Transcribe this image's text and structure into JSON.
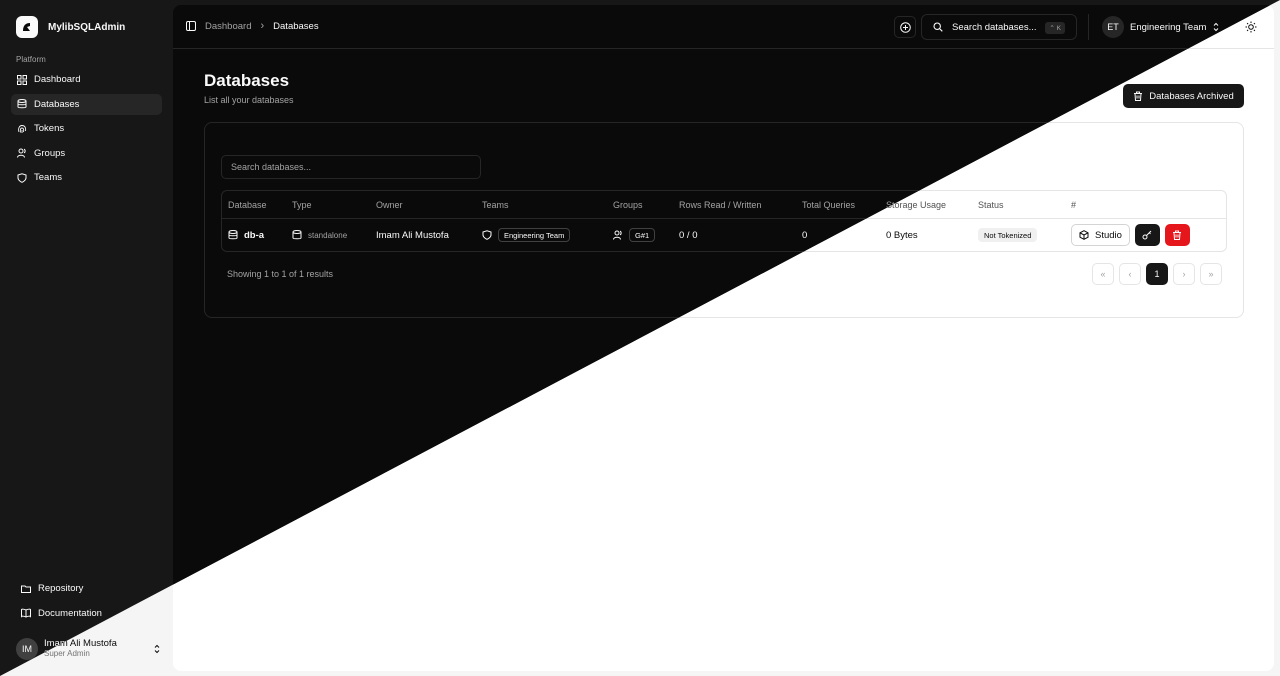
{
  "app": {
    "name": "MylibSQLAdmin"
  },
  "sidebar": {
    "section_label": "Platform",
    "items": [
      {
        "label": "Dashboard",
        "icon": "grid-icon"
      },
      {
        "label": "Databases",
        "icon": "database-icon",
        "active": true
      },
      {
        "label": "Tokens",
        "icon": "fingerprint-icon"
      },
      {
        "label": "Groups",
        "icon": "users-icon"
      },
      {
        "label": "Teams",
        "icon": "team-shield-icon"
      }
    ],
    "bottom_items": [
      {
        "label": "Repository",
        "icon": "folder-icon"
      },
      {
        "label": "Documentation",
        "icon": "book-icon"
      }
    ],
    "user": {
      "initials": "IM",
      "name": "Imam Ali Mustofa",
      "role": "Super Admin"
    }
  },
  "header": {
    "breadcrumb": [
      "Dashboard",
      "Databases"
    ],
    "search_label": "Search databases...",
    "search_shortcut": "⌃ K",
    "team": {
      "initials": "ET",
      "name": "Engineering Team"
    }
  },
  "page": {
    "title": "Databases",
    "subtitle": "List all your databases",
    "archived_button": "Databases Archived"
  },
  "table": {
    "search_placeholder": "Search databases...",
    "columns": [
      "Database",
      "Type",
      "Owner",
      "Teams",
      "Groups",
      "Rows Read / Written",
      "Total Queries",
      "Storage Usage",
      "Status",
      "#"
    ],
    "rows": [
      {
        "database": "db-a",
        "type": "standalone",
        "owner": "Imam Ali Mustofa",
        "team": "Engineering Team",
        "group": "G#1",
        "rows_rw": "0 / 0",
        "total_queries": "0",
        "storage": "0 Bytes",
        "status": "Not Tokenized",
        "studio_label": "Studio"
      }
    ],
    "showing": "Showing 1 to 1 of 1 results",
    "current_page": "1"
  },
  "colors": {
    "dark_bg": "#0a0a0a",
    "light_bg": "#ffffff",
    "danger": "#e5161c"
  }
}
